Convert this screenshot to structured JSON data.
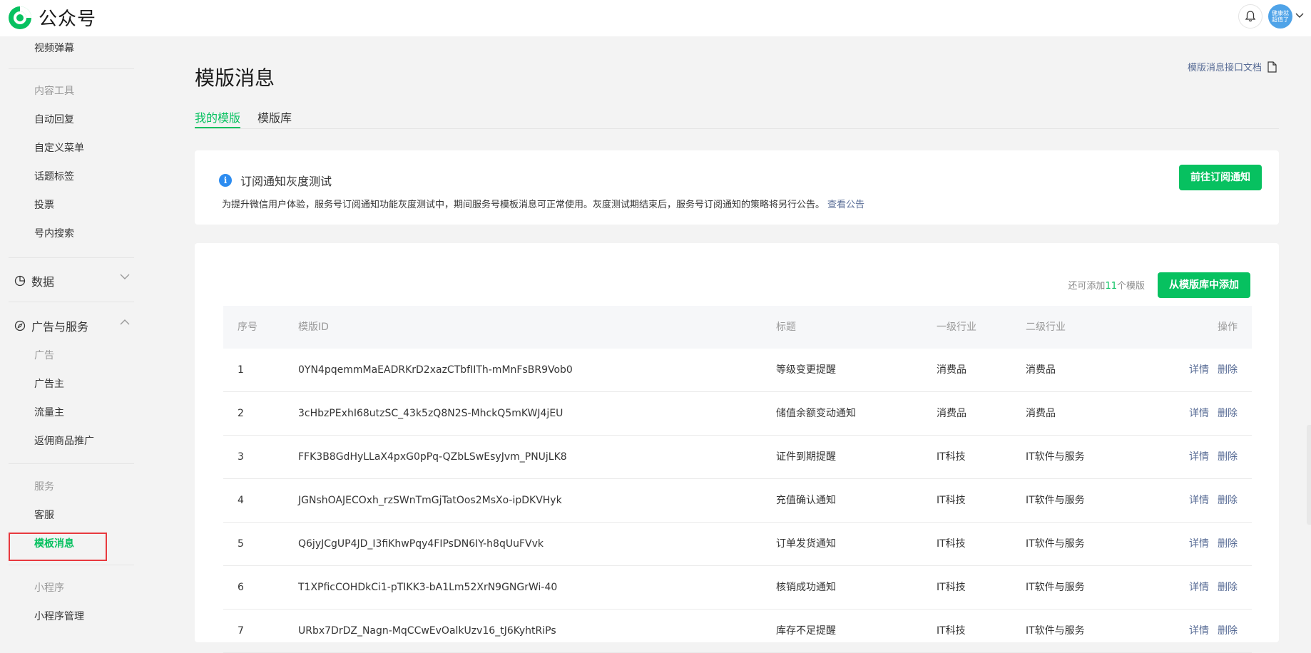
{
  "app": {
    "name": "公众号",
    "avatar_text_1": "健康就",
    "avatar_text_2": "超值了"
  },
  "sidebar": {
    "item_top": "视频弹幕",
    "group_content_tools": "内容工具",
    "content_tools": [
      "自动回复",
      "自定义菜单",
      "话题标签",
      "投票",
      "号内搜索"
    ],
    "section_data": "数据",
    "section_ads": "广告与服务",
    "group_ads": "广告",
    "ads_items": [
      "广告主",
      "流量主",
      "返佣商品推广"
    ],
    "group_service": "服务",
    "service_items": [
      "客服",
      "模板消息"
    ],
    "group_mini": "小程序",
    "mini_items": [
      "小程序管理"
    ]
  },
  "main": {
    "title": "模版消息",
    "doc_link": "模版消息接口文档",
    "tabs": [
      {
        "label": "我的模版",
        "active": true
      },
      {
        "label": "模版库",
        "active": false
      }
    ],
    "notice": {
      "title": "订阅通知灰度测试",
      "description": "为提升微信用户体验，服务号订阅通知功能灰度测试中，期间服务号模板消息可正常使用。灰度测试期结束后，服务号订阅通知的策略将另行公告。",
      "link": "查看公告",
      "button": "前往订阅通知"
    },
    "remain_prefix": "还可添加",
    "remain_count": "11",
    "remain_suffix": "个模版",
    "add_button": "从模版库中添加",
    "table": {
      "headers": [
        "序号",
        "模版ID",
        "标题",
        "一级行业",
        "二级行业",
        "操作"
      ],
      "rows": [
        {
          "no": "1",
          "id": "0YN4pqemmMaEADRKrD2xazCTbfIITh-mMnFsBR9Vob0",
          "title": "等级变更提醒",
          "ind1": "消费品",
          "ind2": "消费品"
        },
        {
          "no": "2",
          "id": "3cHbzPExhI68utzSC_43k5zQ8N2S-MhckQ5mKWJ4jEU",
          "title": "储值余额变动通知",
          "ind1": "消费品",
          "ind2": "消费品"
        },
        {
          "no": "3",
          "id": "FFK3B8GdHyLLaX4pxG0pPq-QZbLSwEsyJvm_PNUjLK8",
          "title": "证件到期提醒",
          "ind1": "IT科技",
          "ind2": "IT软件与服务"
        },
        {
          "no": "4",
          "id": "JGNshOAJECOxh_rzSWnTmGjTatOos2MsXo-ipDKVHyk",
          "title": "充值确认通知",
          "ind1": "IT科技",
          "ind2": "IT软件与服务"
        },
        {
          "no": "5",
          "id": "Q6jyJCgUP4JD_I3fiKhwPqy4FIPsDN6IY-h8qUuFVvk",
          "title": "订单发货通知",
          "ind1": "IT科技",
          "ind2": "IT软件与服务"
        },
        {
          "no": "6",
          "id": "T1XPficCOHDkCi1-pTIKK3-bA1Lm52XrN9GNGrWi-40",
          "title": "核销成功通知",
          "ind1": "IT科技",
          "ind2": "IT软件与服务"
        },
        {
          "no": "7",
          "id": "URbx7DrDZ_Nagn-MqCCwEvOalkUzv16_tJ6KyhtRiPs",
          "title": "库存不足提醒",
          "ind1": "IT科技",
          "ind2": "IT软件与服务"
        }
      ],
      "op_detail": "详情",
      "op_delete": "删除"
    }
  },
  "colors": {
    "accent": "#07c160",
    "link": "#576b95",
    "highlight": "#e8393e"
  }
}
